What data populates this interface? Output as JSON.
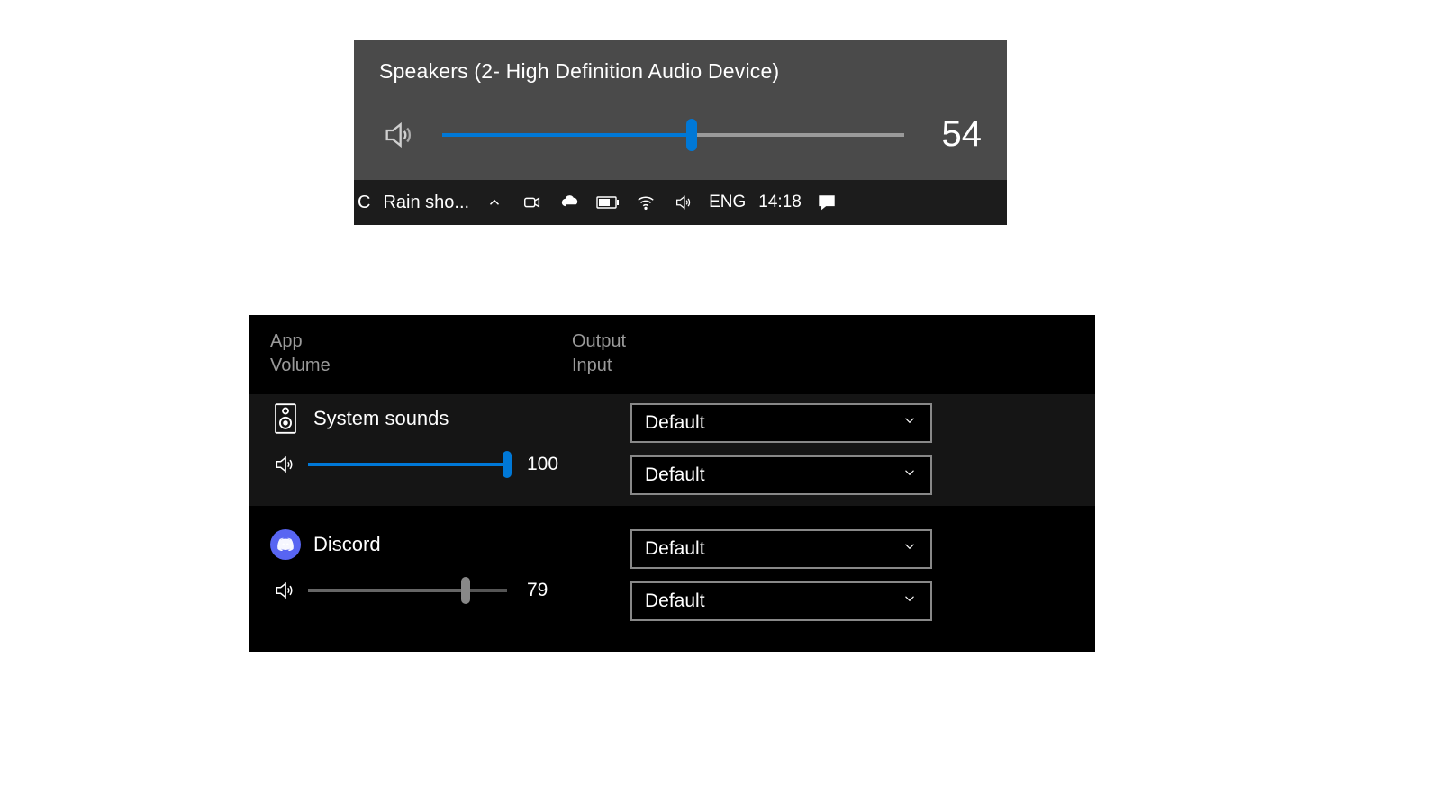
{
  "flyout": {
    "device_title": "Speakers (2- High Definition Audio Device)",
    "volume": 54,
    "volume_str": "54"
  },
  "taskbar": {
    "weather_prefix": "C",
    "weather_text": "Rain sho...",
    "lang": "ENG",
    "time": "14:18"
  },
  "mixer": {
    "header_left_line1": "App",
    "header_left_line2": "Volume",
    "header_right_line1": "Output",
    "header_right_line2": "Input",
    "apps": [
      {
        "name": "System sounds",
        "volume": 100,
        "volume_str": "100",
        "output": "Default",
        "input": "Default",
        "active": true,
        "slider_grey": false
      },
      {
        "name": "Discord",
        "volume": 79,
        "volume_str": "79",
        "output": "Default",
        "input": "Default",
        "active": false,
        "slider_grey": true
      }
    ]
  }
}
